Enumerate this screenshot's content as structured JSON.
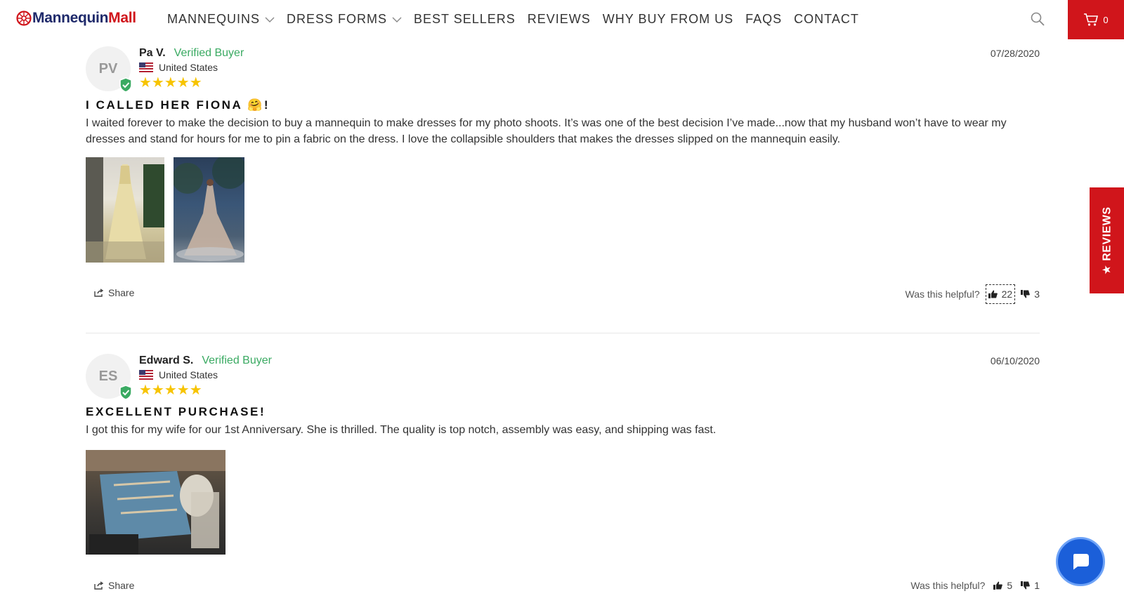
{
  "brand": {
    "logo_part1": "Mannequin",
    "logo_part2": "Mall"
  },
  "nav": {
    "items": [
      {
        "label": "MANNEQUINS",
        "dropdown": true
      },
      {
        "label": "DRESS FORMS",
        "dropdown": true
      },
      {
        "label": "BEST SELLERS",
        "dropdown": false
      },
      {
        "label": "REVIEWS",
        "dropdown": false
      },
      {
        "label": "WHY BUY FROM US",
        "dropdown": false
      },
      {
        "label": "FAQS",
        "dropdown": false
      },
      {
        "label": "CONTACT",
        "dropdown": false
      }
    ],
    "cart_count": "0"
  },
  "reviews_tab": {
    "label": "★ REVIEWS"
  },
  "reviews": [
    {
      "initials": "PV",
      "name": "Pa V.",
      "verified_label": "Verified Buyer",
      "country": "United States",
      "rating": 5,
      "stars": "★★★★★",
      "date": "07/28/2020",
      "title": "I CALLED HER FIONA 🤗!",
      "body": "I waited forever to make the decision to buy a  mannequin to make dresses for my photo shoots. It’s was one of the best decision I’ve made...now that my husband won’t have to wear my dresses and stand for hours for me to pin a fabric on the dress. I love the collapsible shoulders that makes the dresses slipped on the mannequin easily.",
      "share_label": "Share",
      "helpful_label": "Was this helpful?",
      "upvotes": "22",
      "downvotes": "3"
    },
    {
      "initials": "ES",
      "name": "Edward S.",
      "verified_label": "Verified Buyer",
      "country": "United States",
      "rating": 5,
      "stars": "★★★★★",
      "date": "06/10/2020",
      "title": "EXCELLENT PURCHASE!",
      "body": "I got this for my wife for our 1st Anniversary. She is thrilled. The quality is top notch, assembly was easy, and shipping was fast.",
      "share_label": "Share",
      "helpful_label": "Was this helpful?",
      "upvotes": "5",
      "downvotes": "1"
    }
  ],
  "colors": {
    "brand_red": "#d0151b",
    "brand_navy": "#1f2a6b",
    "verified_green": "#3aaa62",
    "star": "#f7c400",
    "chat_blue": "#1b5fd9"
  }
}
